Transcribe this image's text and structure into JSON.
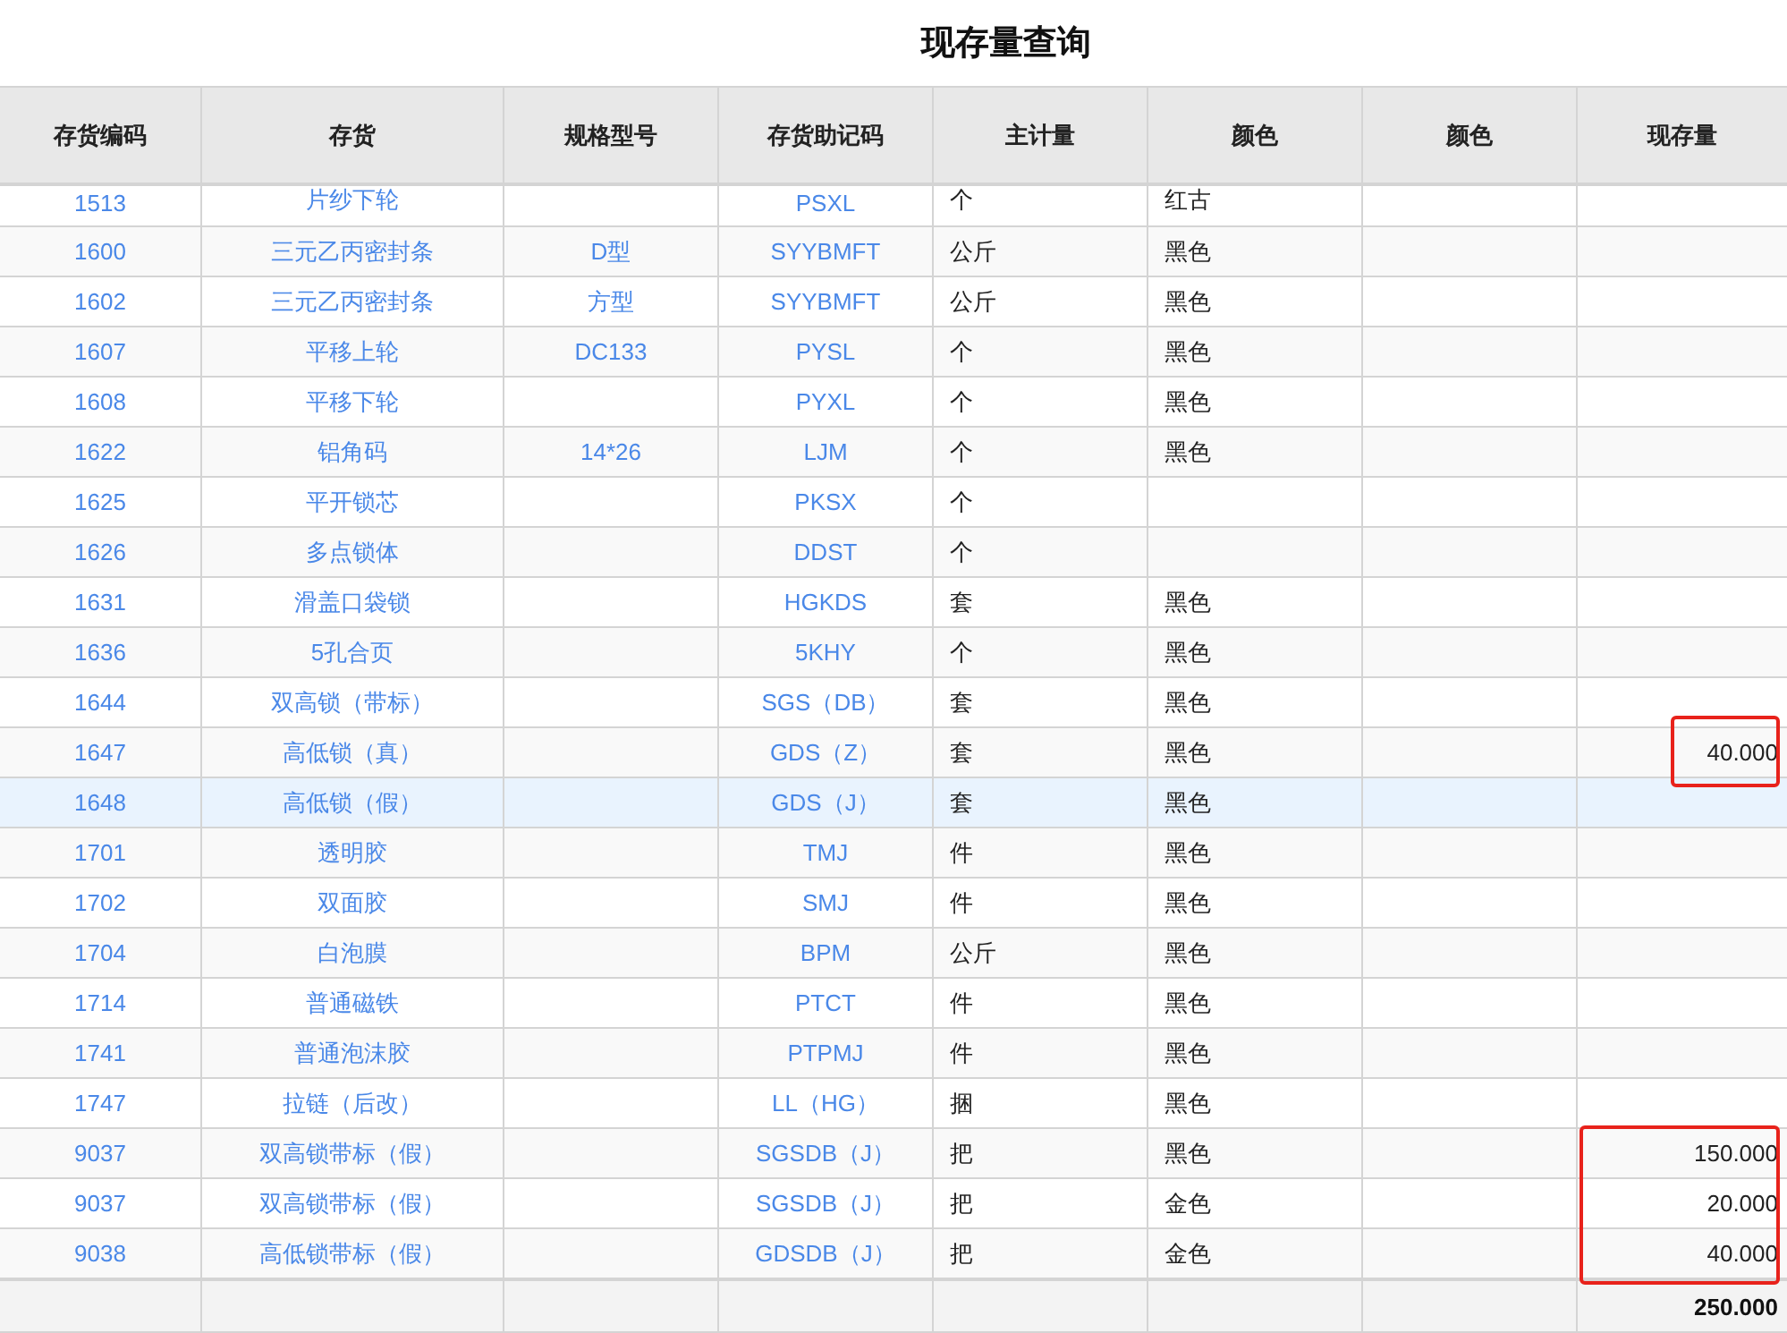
{
  "title": "现存量查询",
  "columns": [
    "存货编码",
    "存货",
    "规格型号",
    "存货助记码",
    "主计量",
    "颜色",
    "颜色",
    "现存量"
  ],
  "rows": [
    {
      "code": "1513",
      "name": "片纱下轮",
      "mnemonic": "PSXL",
      "unit": "个",
      "color_name": "红古",
      "selected": false,
      "highlighted": false
    },
    {
      "code": "1600",
      "name": "三元乙丙密封条",
      "spec": "D型",
      "mnemonic": "SYYBMFT",
      "unit": "公斤",
      "color_name": "黑色",
      "selected": false,
      "highlighted": false
    },
    {
      "code": "1602",
      "name": "三元乙丙密封条",
      "spec": "方型",
      "mnemonic": "SYYBMFT",
      "unit": "公斤",
      "color_name": "黑色",
      "selected": false,
      "highlighted": false
    },
    {
      "code": "1607",
      "name": "平移上轮",
      "spec": "DC133",
      "mnemonic": "PYSL",
      "unit": "个",
      "color_name": "黑色",
      "selected": false,
      "highlighted": false
    },
    {
      "code": "1608",
      "name": "平移下轮",
      "mnemonic": "PYXL",
      "unit": "个",
      "color_name": "黑色",
      "selected": false,
      "highlighted": false
    },
    {
      "code": "1622",
      "name": "铝角码",
      "spec": "14*26",
      "mnemonic": "LJM",
      "unit": "个",
      "color_name": "黑色",
      "selected": false,
      "highlighted": false
    },
    {
      "code": "1625",
      "name": "平开锁芯",
      "mnemonic": "PKSX",
      "unit": "个",
      "selected": false,
      "highlighted": false
    },
    {
      "code": "1626",
      "name": "多点锁体",
      "mnemonic": "DDST",
      "unit": "个",
      "selected": false,
      "highlighted": false
    },
    {
      "code": "1631",
      "name": "滑盖口袋锁",
      "mnemonic": "HGKDS",
      "unit": "套",
      "color_name": "黑色",
      "selected": false,
      "highlighted": false
    },
    {
      "code": "1636",
      "name": "5孔合页",
      "mnemonic": "5KHY",
      "unit": "个",
      "color_name": "黑色",
      "selected": false,
      "highlighted": false
    },
    {
      "code": "1644",
      "name": "双高锁（带标）",
      "mnemonic": "SGS（DB）",
      "unit": "套",
      "color_name": "黑色",
      "selected": false,
      "highlighted": false
    },
    {
      "code": "1647",
      "name": "高低锁（真）",
      "mnemonic": "GDS（Z）",
      "unit": "套",
      "color_name": "黑色",
      "quantity": "40.000",
      "selected": false,
      "highlighted": true
    },
    {
      "code": "1648",
      "name": "高低锁（假）",
      "mnemonic": "GDS（J）",
      "unit": "套",
      "color_name": "黑色",
      "selected": true,
      "highlighted": false
    },
    {
      "code": "1701",
      "name": "透明胶",
      "mnemonic": "TMJ",
      "unit": "件",
      "color_name": "黑色",
      "selected": false,
      "highlighted": false
    },
    {
      "code": "1702",
      "name": "双面胶",
      "mnemonic": "SMJ",
      "unit": "件",
      "color_name": "黑色",
      "selected": false,
      "highlighted": false
    },
    {
      "code": "1704",
      "name": "白泡膜",
      "mnemonic": "BPM",
      "unit": "公斤",
      "color_name": "黑色",
      "selected": false,
      "highlighted": false
    },
    {
      "code": "1714",
      "name": "普通磁铁",
      "mnemonic": "PTCT",
      "unit": "件",
      "color_name": "黑色",
      "selected": false,
      "highlighted": false
    },
    {
      "code": "1741",
      "name": "普通泡沫胶",
      "mnemonic": "PTPMJ",
      "unit": "件",
      "color_name": "黑色",
      "selected": false,
      "highlighted": false
    },
    {
      "code": "1747",
      "name": "拉链（后改）",
      "mnemonic": "LL（HG）",
      "unit": "捆",
      "color_name": "黑色",
      "selected": false,
      "highlighted": false
    },
    {
      "code": "9037",
      "name": "双高锁带标（假）",
      "mnemonic": "SGSDB（J）",
      "unit": "把",
      "color_name": "黑色",
      "quantity": "150.000",
      "selected": false,
      "highlighted": true
    },
    {
      "code": "9037",
      "name": "双高锁带标（假）",
      "mnemonic": "SGSDB（J）",
      "unit": "把",
      "color_name": "金色",
      "quantity": "20.000",
      "selected": false,
      "highlighted": true
    },
    {
      "code": "9038",
      "name": "高低锁带标（假）",
      "mnemonic": "GDSDB（J）",
      "unit": "把",
      "color_name": "金色",
      "quantity": "40.000",
      "selected": false,
      "highlighted": true
    }
  ],
  "footer": {
    "total_quantity": "250.000"
  }
}
